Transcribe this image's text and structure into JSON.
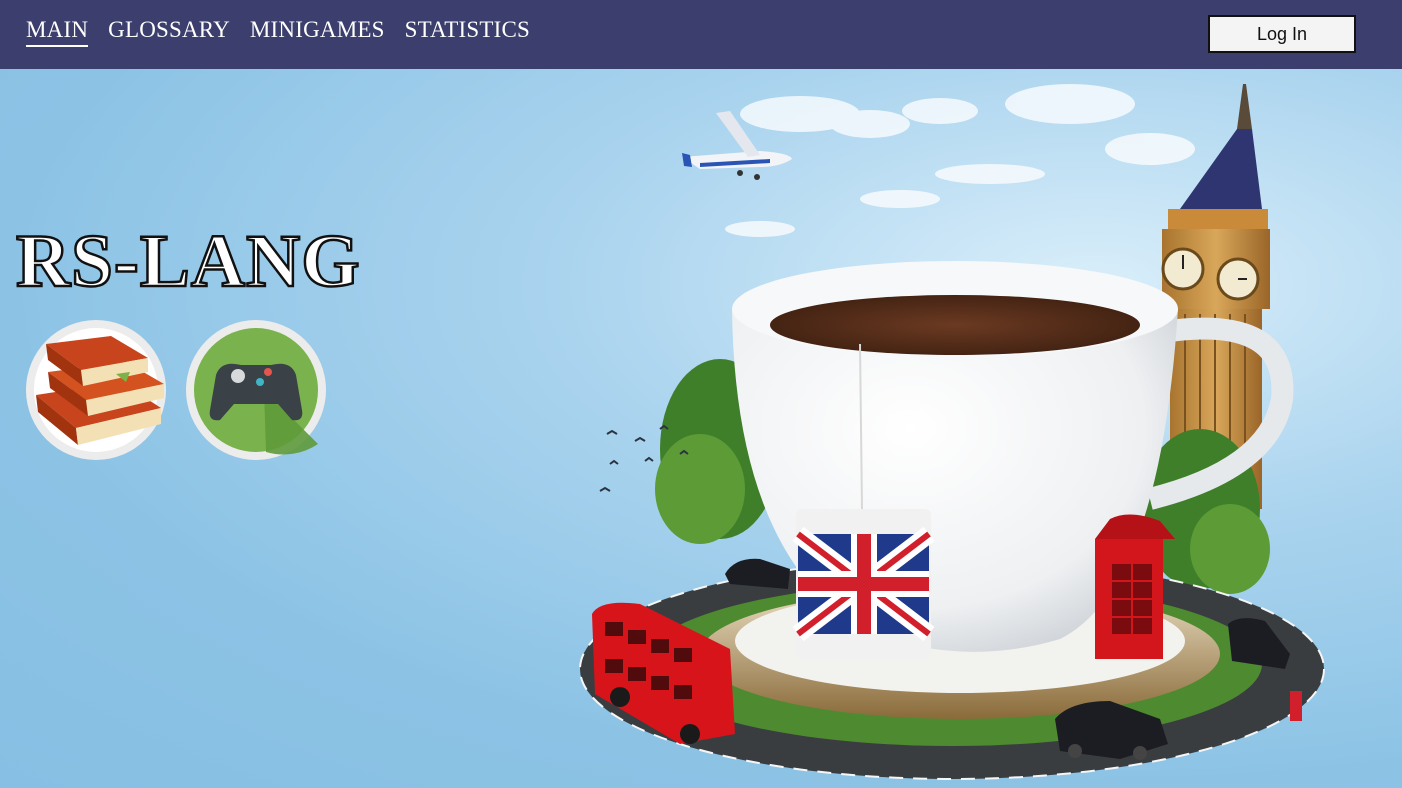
{
  "nav": {
    "links": [
      {
        "label": "MAIN",
        "active": true
      },
      {
        "label": "GLOSSARY",
        "active": false
      },
      {
        "label": "MINIGAMES",
        "active": false
      },
      {
        "label": "STATISTICS",
        "active": false
      }
    ],
    "login_label": "Log In"
  },
  "hero": {
    "title": "RS-LANG",
    "buttons": [
      {
        "name": "glossary-shortcut",
        "icon": "books-icon"
      },
      {
        "name": "minigames-shortcut",
        "icon": "gamepad-icon"
      }
    ]
  },
  "colors": {
    "navbar": "#3c3f6d",
    "sky": "#8fc4e6",
    "games_circle": "#7ab34e"
  }
}
